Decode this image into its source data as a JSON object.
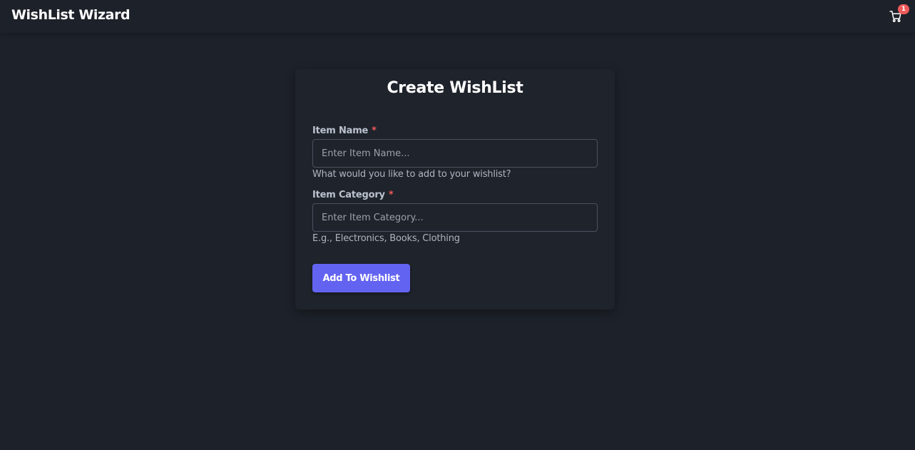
{
  "app": {
    "brand": "WishList Wizard"
  },
  "cart": {
    "icon": "cart-icon",
    "badge_count": "1"
  },
  "form": {
    "title": "Create WishList",
    "item_name": {
      "label": "Item Name",
      "required_mark": "*",
      "placeholder": "Enter Item Name...",
      "value": "",
      "helper": "What would you like to add to your wishlist?"
    },
    "item_category": {
      "label": "Item Category",
      "required_mark": "*",
      "placeholder": "Enter Item Category...",
      "value": "",
      "helper": "E.g., Electronics, Books, Clothing"
    },
    "submit_label": "Add To Wishlist"
  },
  "colors": {
    "background": "#1d2129",
    "card": "#1f232b",
    "accent": "#6363f2",
    "required": "#f05a5a",
    "badge": "#f05a5a"
  }
}
